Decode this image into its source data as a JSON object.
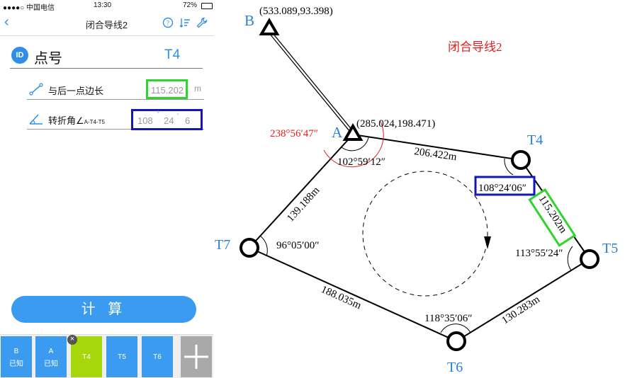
{
  "status_bar": {
    "carrier": "●●●●○ 中国电信",
    "time": "13:30",
    "battery": "72%"
  },
  "nav": {
    "title": "闭合导线2"
  },
  "header": {
    "badge": "ID",
    "label": "点号",
    "value": "T4"
  },
  "fields": {
    "back_distance": {
      "label": "与后一点边长",
      "value": "115.202",
      "unit": "m"
    },
    "turn_angle": {
      "label": "转折角∠",
      "subscript": "A-T4-T5",
      "deg": "108",
      "min": "24",
      "sec": "6"
    }
  },
  "calc_button": "计 算",
  "tabs": [
    {
      "line1": "B",
      "line2": "已知"
    },
    {
      "line1": "A",
      "line2": "已知"
    },
    {
      "line1": "T4",
      "line2": ""
    },
    {
      "line1": "T5",
      "line2": ""
    },
    {
      "line1": "T6",
      "line2": ""
    }
  ],
  "diagram": {
    "title": "闭合导线2",
    "points": {
      "B": "B",
      "A": "A",
      "T4": "T4",
      "T5": "T5",
      "T6": "T6",
      "T7": "T7"
    },
    "coords": {
      "B": "(533.089,93.398)",
      "A": "(285.024,198.471)"
    },
    "angles": {
      "A_outer": "238°56′47″",
      "A_inner": "102°59′12″",
      "T4": "108°24′06″",
      "T5": "113°55′24″",
      "T6": "118°35′06″",
      "T7": "96°05′00″"
    },
    "distances": {
      "A_T4": "206.422m",
      "T4_T5": "115.202m",
      "T5_T6": "130.283m",
      "T6_T7": "188.035m",
      "T7_A": "139.188m"
    },
    "colors": {
      "blue": "#2a7fd8",
      "red": "#e02020",
      "green": "#2fd42f",
      "navy": "#1515b8"
    }
  }
}
